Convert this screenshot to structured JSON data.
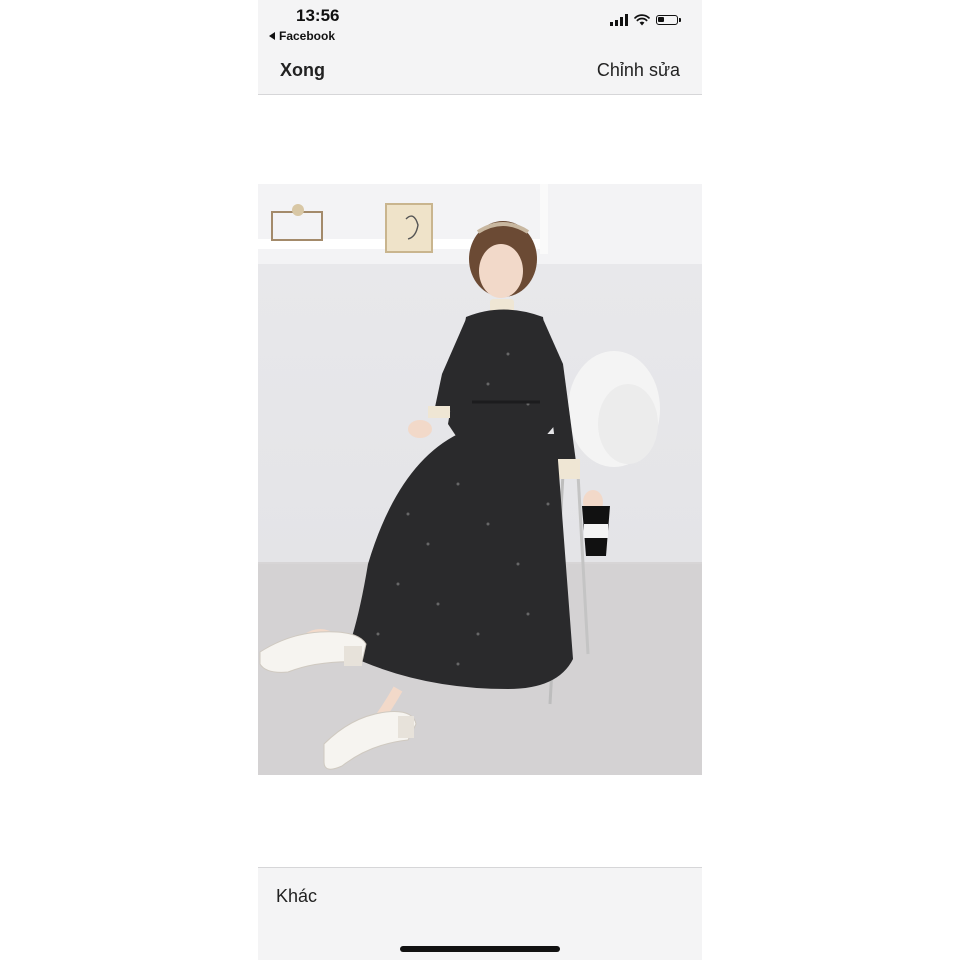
{
  "status_bar": {
    "time": "13:56",
    "back_app": "Facebook",
    "battery_level": 0.35,
    "icons": [
      "cellular-signal-icon",
      "wifi-icon",
      "battery-icon"
    ]
  },
  "nav": {
    "done_label": "Xong",
    "edit_label": "Chỉnh sửa"
  },
  "photo": {
    "subject": "woman-in-black-floral-midi-dress-photo"
  },
  "bottom": {
    "other_label": "Khác"
  },
  "colors": {
    "bar_background": "#f4f4f5",
    "text": "#222222",
    "dress": "#2a2a2c"
  }
}
